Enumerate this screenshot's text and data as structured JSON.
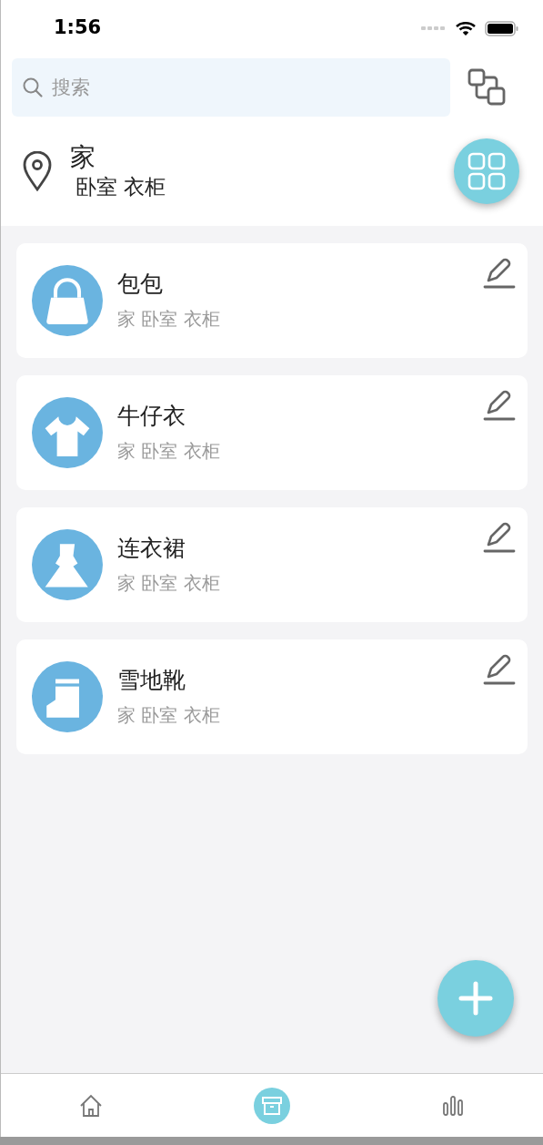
{
  "status_bar": {
    "time": "1:56"
  },
  "search": {
    "placeholder": "搜索"
  },
  "location": {
    "title": "家",
    "path": "卧室 衣柜"
  },
  "items": [
    {
      "kind": "bag",
      "name": "包包",
      "path": "家 卧室 衣柜"
    },
    {
      "kind": "shirt",
      "name": "牛仔衣",
      "path": "家 卧室 衣柜"
    },
    {
      "kind": "dress",
      "name": "连衣裙",
      "path": "家 卧室 衣柜"
    },
    {
      "kind": "boot",
      "name": "雪地靴",
      "path": "家 卧室 衣柜"
    }
  ],
  "tabs": [
    {
      "kind": "home",
      "selected": false
    },
    {
      "kind": "box",
      "selected": true
    },
    {
      "kind": "stats",
      "selected": false
    }
  ]
}
